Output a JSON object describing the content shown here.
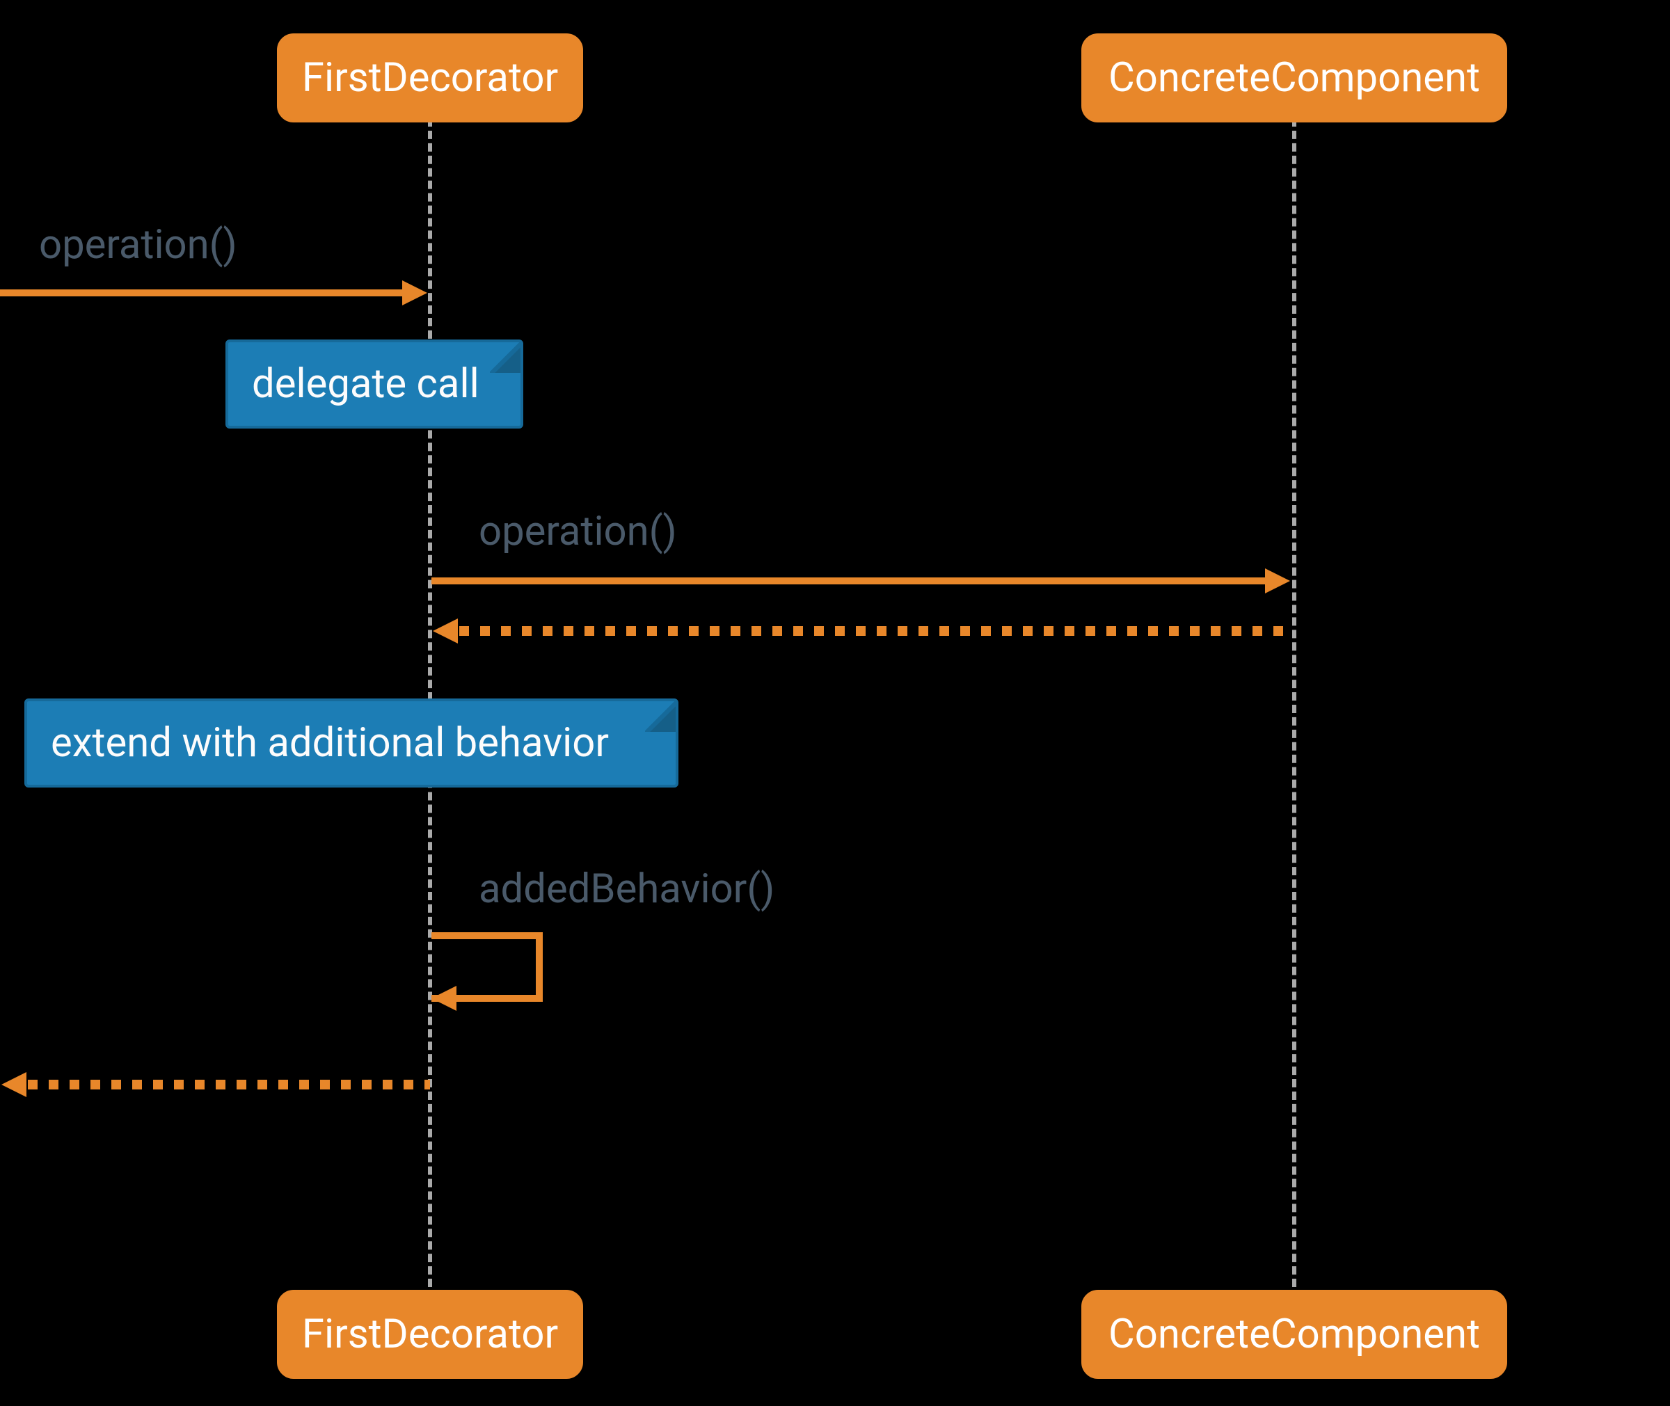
{
  "participants": {
    "first_decorator": "FirstDecorator",
    "concrete_component": "ConcreteComponent"
  },
  "messages": {
    "operation_in": "operation()",
    "operation_fwd": "operation()",
    "added_behavior": "addedBehavior()"
  },
  "notes": {
    "delegate": "delegate call",
    "extend": "extend with additional behavior"
  },
  "colors": {
    "participant_fill": "#e8872a",
    "note_fill": "#1c7db5",
    "label_text": "#4a5a6a",
    "lifeline": "#aaaaaa"
  }
}
